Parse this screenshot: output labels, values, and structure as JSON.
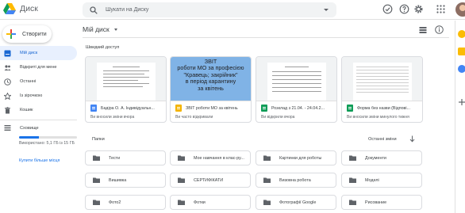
{
  "app": {
    "title": "Диск"
  },
  "search": {
    "placeholder": "Шукати на Диску"
  },
  "sidebar": {
    "new_button": "Створити",
    "items": [
      {
        "label": "Мій диск",
        "icon": "my-drive-icon",
        "active": true
      },
      {
        "label": "Відкриті для мене",
        "icon": "shared-icon",
        "active": false
      },
      {
        "label": "Останні",
        "icon": "clock-icon",
        "active": false
      },
      {
        "label": "Із зірочкою",
        "icon": "star-icon",
        "active": false
      },
      {
        "label": "Кошик",
        "icon": "trash-icon",
        "active": false
      }
    ],
    "storage": {
      "label": "Сховище",
      "usage_text": "Використано: 5,1 ГБ із 15 ГБ",
      "used_fraction": 0.34,
      "buy_link": "Купити більше місця"
    }
  },
  "main": {
    "title": "Мій диск",
    "quick_access_label": "Швидкий доступ",
    "cards": [
      {
        "name": "Бадіра О. А. Індивідуальн...",
        "subtitle": "Ви вносили зміни вчора",
        "file_type": "docs",
        "icon_color": "#4285f4",
        "thumb": "doc"
      },
      {
        "name": "ЗВІТ роботи МО за квітень",
        "subtitle": "Ви часто відкривали",
        "file_type": "slides",
        "icon_color": "#f4b400",
        "thumb": "blue",
        "thumb_text": "ЗВІТ\nроботи МО за професією\n\"Кравець; закрійник\"\nв період карантину\nза квітень"
      },
      {
        "name": "Розклад з 21.04. - 24.04.2...",
        "subtitle": "Ви відкрили вчора",
        "file_type": "sheets",
        "icon_color": "#0f9d58",
        "thumb": "doc"
      },
      {
        "name": "Форма без назви (Відпові...",
        "subtitle": "Ви вносили зміни минулого тижня",
        "file_type": "sheets",
        "icon_color": "#0f9d58",
        "thumb": "sheet"
      }
    ],
    "folders_label": "Папки",
    "sort_label": "Останні зміни",
    "folders": [
      "Тести",
      "Мое навчання в клас-ру...",
      "Картинки для роботы",
      "Документи",
      "Вишивка",
      "СЕРТИФІКАТИ",
      "Визовна робота",
      "Моделі",
      "Фото2",
      "Фотки",
      "Фотографії Google",
      "Рисование"
    ]
  },
  "colors": {
    "accent": "#1a73e8",
    "active_bg": "#e8f0fe",
    "slides_thumb": "#80b3e6"
  }
}
